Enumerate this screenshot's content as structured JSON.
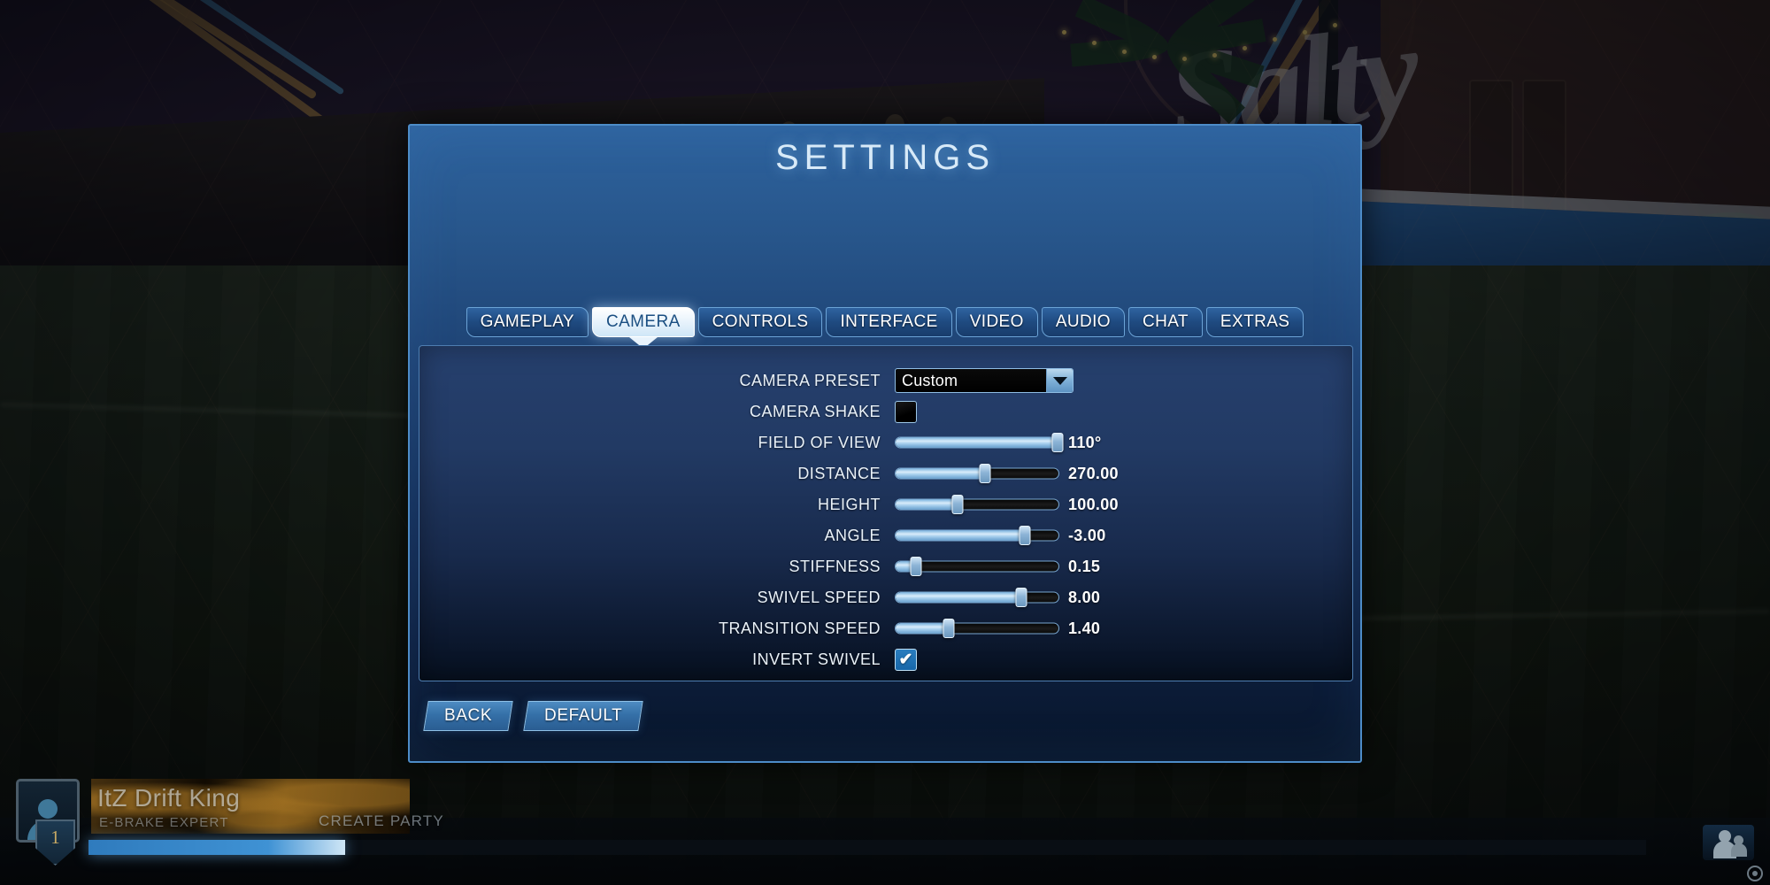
{
  "window": {
    "title": "SETTINGS",
    "tabs": [
      {
        "label": "GAMEPLAY",
        "active": false
      },
      {
        "label": "CAMERA",
        "active": true
      },
      {
        "label": "CONTROLS",
        "active": false
      },
      {
        "label": "INTERFACE",
        "active": false
      },
      {
        "label": "VIDEO",
        "active": false
      },
      {
        "label": "AUDIO",
        "active": false
      },
      {
        "label": "CHAT",
        "active": false
      },
      {
        "label": "EXTRAS",
        "active": false
      }
    ],
    "settings": [
      {
        "label": "CAMERA PRESET",
        "type": "dropdown",
        "value": "Custom"
      },
      {
        "label": "CAMERA SHAKE",
        "type": "checkbox",
        "checked": false,
        "mark": ""
      },
      {
        "label": "FIELD OF VIEW",
        "type": "slider",
        "value": "110°",
        "fill_pct": 99
      },
      {
        "label": "DISTANCE",
        "type": "slider",
        "value": "270.00",
        "fill_pct": 55
      },
      {
        "label": "HEIGHT",
        "type": "slider",
        "value": "100.00",
        "fill_pct": 38
      },
      {
        "label": "ANGLE",
        "type": "slider",
        "value": "-3.00",
        "fill_pct": 79
      },
      {
        "label": "STIFFNESS",
        "type": "slider",
        "value": "0.15",
        "fill_pct": 13
      },
      {
        "label": "SWIVEL SPEED",
        "type": "slider",
        "value": "8.00",
        "fill_pct": 77
      },
      {
        "label": "TRANSITION SPEED",
        "type": "slider",
        "value": "1.40",
        "fill_pct": 33
      },
      {
        "label": "INVERT SWIVEL",
        "type": "checkbox",
        "checked": true,
        "mark": "✔"
      }
    ],
    "buttons": [
      {
        "label": "BACK"
      },
      {
        "label": "DEFAULT"
      }
    ]
  },
  "hud": {
    "player_name": "ItZ Drift King",
    "player_title": "E-BRAKE EXPERT",
    "level": "1",
    "create_party": "CREATE PARTY"
  },
  "background": {
    "graffiti_text": "Salty"
  },
  "colors": {
    "accent": "#4d8cc8",
    "panel": "#1e3158",
    "tab_active_text": "#1b4f82",
    "slider_fill": "#a7cfee",
    "xp_fill": "#3f92d4",
    "level_text": "#c8a964"
  }
}
